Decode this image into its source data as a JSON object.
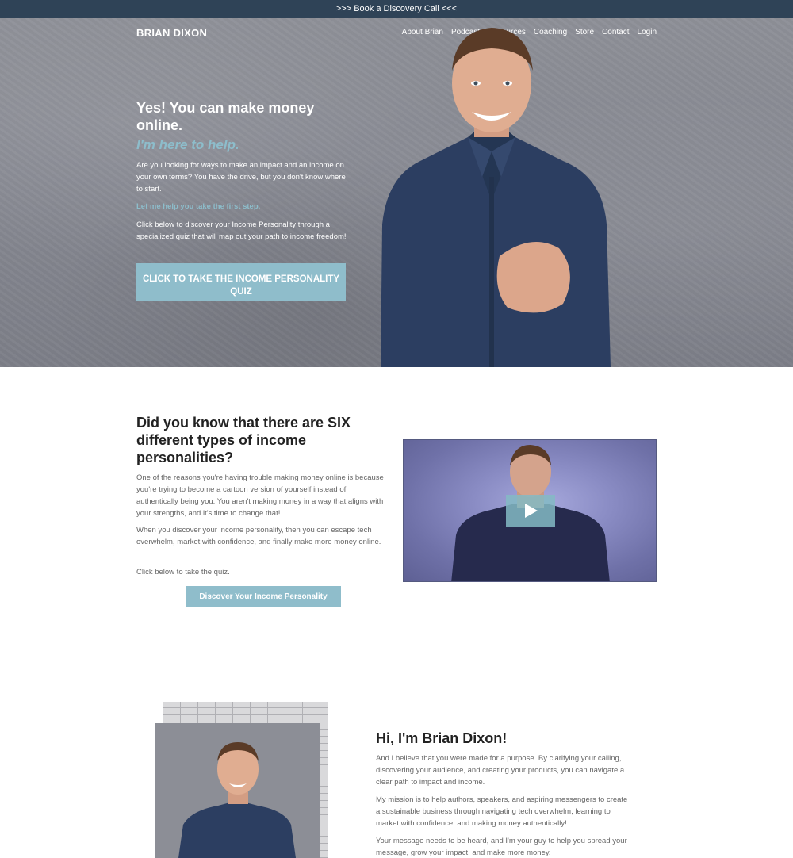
{
  "topbar": {
    "text": ">>> Book a Discovery Call <<<"
  },
  "header": {
    "brand": "BRIAN DIXON",
    "nav": [
      "About Brian",
      "Podcast",
      "Resources",
      "Coaching",
      "Store",
      "Contact",
      "Login"
    ]
  },
  "hero": {
    "headline": "Yes! You can make money online.",
    "subheadline": "I'm here to help.",
    "paragraph1": "Are you looking for ways to make an impact and an income on your own terms? You have the drive, but you don't know where to start.",
    "accent": "Let me help you take the first step.",
    "paragraph2": "Click below to discover your Income Personality through a specialized quiz that will map out your path to income freedom!",
    "cta": "CLICK TO TAKE THE INCOME PERSONALITY QUIZ"
  },
  "personality": {
    "heading": "Did you know that there are SIX different types of income personalities?",
    "p1": "One of the reasons you're having trouble making money online is because you're trying to become a cartoon version of yourself instead of authentically being you. You aren't making money in a way that aligns with your strengths, and it's time to change that!",
    "p2": "When you discover your income personality, then you can escape tech overwhelm, market with confidence, and finally make more money online.",
    "p3": "Click below to take the quiz.",
    "button": "Discover Your Income Personality"
  },
  "about": {
    "heading": "Hi, I'm Brian Dixon!",
    "p1": "And I believe that you were made for a purpose. By clarifying your calling, discovering your audience, and creating your products, you can navigate a clear path to impact and income.",
    "p2": "My mission is to help authors, speakers, and aspiring messengers to create a sustainable business through navigating tech overwhelm, learning to market with confidence, and making money authentically!",
    "p3": "Your message needs to be heard, and I'm your guy to help you spread your message, grow your impact, and make more money."
  },
  "colors": {
    "topbar": "#2f4357",
    "accent": "#8fbdcb"
  }
}
